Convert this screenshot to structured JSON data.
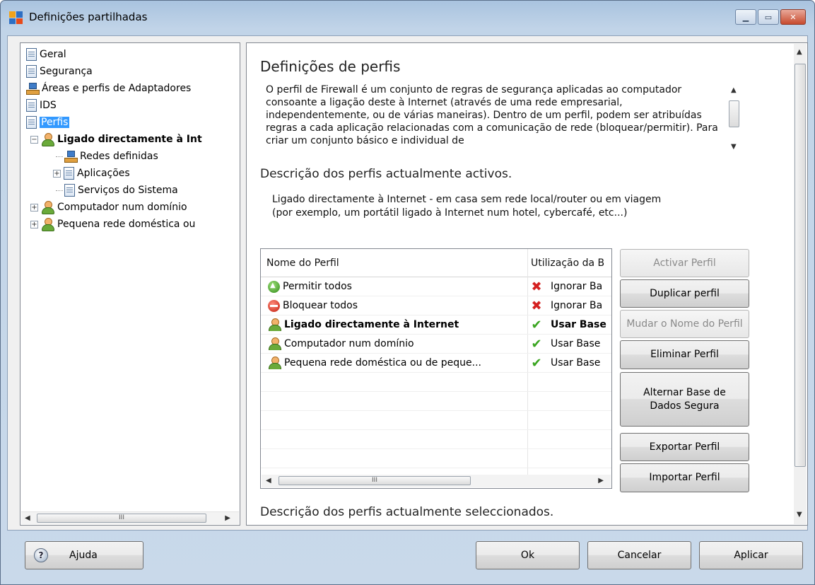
{
  "window": {
    "title": "Definições partilhadas"
  },
  "tree": {
    "items": [
      {
        "label": "Geral"
      },
      {
        "label": "Segurança"
      },
      {
        "label": "Áreas e perfis de Adaptadores"
      },
      {
        "label": "IDS"
      },
      {
        "label": "Perfis"
      },
      {
        "label": "Ligado directamente à Int"
      },
      {
        "label": "Redes definidas"
      },
      {
        "label": "Aplicações"
      },
      {
        "label": "Serviços do Sistema"
      },
      {
        "label": "Computador num domínio"
      },
      {
        "label": "Pequena rede doméstica ou"
      }
    ]
  },
  "content": {
    "heading": "Definições de perfis",
    "description": "O perfil de Firewall é um conjunto de regras de segurança aplicadas ao computador consoante a ligação deste à Internet (através de uma rede empresarial, independentemente, ou de várias maneiras). Dentro de um perfil, podem ser atribuídas regras a cada aplicação relacionadas com a comunicação de rede (bloquear/permitir). Para criar um conjunto básico e individual de",
    "active_heading": "Descrição dos perfis actualmente activos.",
    "active_text_1": "Ligado directamente à Internet - em casa sem rede local/router ou em viagem",
    "active_text_2": "(por exemplo, um portátil ligado à Internet num hotel, cybercafé, etc...)",
    "selected_heading": "Descrição dos perfis actualmente seleccionados."
  },
  "list": {
    "columns": [
      "Nome do Perfil",
      "Utilização da B"
    ],
    "rows": [
      {
        "name": "Permitir todos",
        "db": "Ignorar Ba",
        "icon": "allow-icon",
        "db_icon": "cross-icon",
        "bold": false
      },
      {
        "name": "Bloquear todos",
        "db": "Ignorar Ba",
        "icon": "block-icon",
        "db_icon": "cross-icon",
        "bold": false
      },
      {
        "name": "Ligado directamente à Internet",
        "db": "Usar Base",
        "icon": "user-icon",
        "db_icon": "check-icon",
        "bold": true
      },
      {
        "name": "Computador num domínio",
        "db": "Usar Base",
        "icon": "user-icon",
        "db_icon": "check-icon",
        "bold": false
      },
      {
        "name": "Pequena rede doméstica ou de peque...",
        "db": "Usar Base",
        "icon": "user-icon",
        "db_icon": "check-icon",
        "bold": false
      }
    ]
  },
  "actions": {
    "activate": "Activar Perfil",
    "duplicate": "Duplicar perfil",
    "rename": "Mudar o Nome do Perfil",
    "delete": "Eliminar Perfil",
    "toggle_db": "Alternar Base de Dados Segura",
    "export": "Exportar Perfil",
    "import": "Importar Perfil"
  },
  "footer": {
    "help": "Ajuda",
    "ok": "Ok",
    "cancel": "Cancelar",
    "apply": "Aplicar"
  },
  "scroll_glyph": "III"
}
